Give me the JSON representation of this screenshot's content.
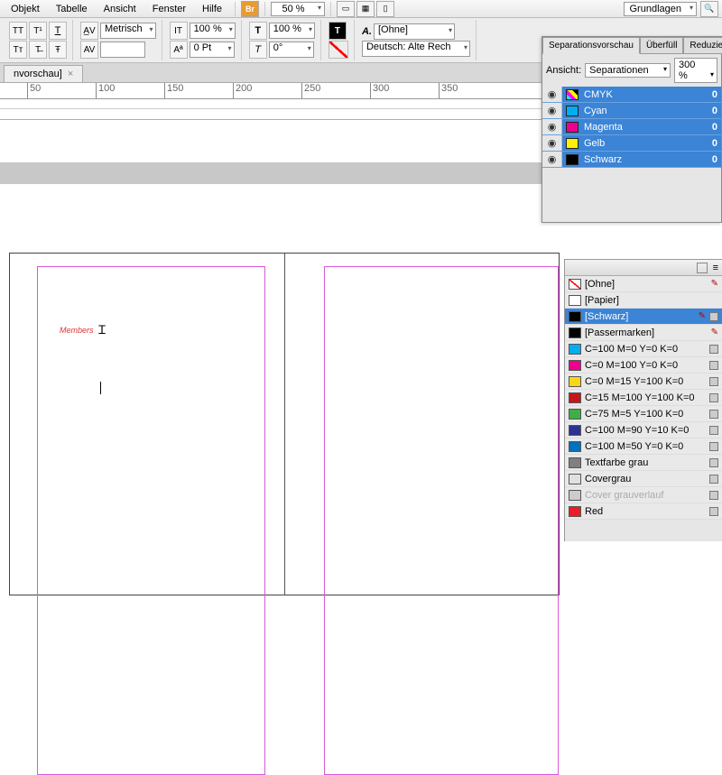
{
  "menu": {
    "items": [
      "Objekt",
      "Tabelle",
      "Ansicht",
      "Fenster",
      "Hilfe"
    ],
    "br": "Br",
    "zoom": "50 %",
    "workspace": "Grundlagen"
  },
  "toolbar": {
    "metric": "Metrisch",
    "pct1": "100 %",
    "pct2": "100 %",
    "pt": "0 Pt",
    "deg": "0°",
    "ohne": "[Ohne]",
    "lang": "Deutsch: Alte Rech"
  },
  "tab": {
    "name": "nvorschau]"
  },
  "ruler": [
    "50",
    "100",
    "150",
    "200",
    "250",
    "300",
    "350"
  ],
  "canvas": {
    "text": "Members"
  },
  "sep": {
    "tabs": [
      "Separationsvorschau",
      "Überfüll",
      "Reduzie"
    ],
    "ansicht_label": "Ansicht:",
    "ansicht_value": "Separationen",
    "zoom": "300 %",
    "rows": [
      {
        "name": "CMYK",
        "color": "linear-gradient(45deg,cyan 25%,magenta 25%,magenta 50%,yellow 50%,yellow 75%,black 75%)",
        "val": "0"
      },
      {
        "name": "Cyan",
        "color": "#00aeef",
        "val": "0"
      },
      {
        "name": "Magenta",
        "color": "#ec008c",
        "val": "0"
      },
      {
        "name": "Gelb",
        "color": "#fff200",
        "val": "0"
      },
      {
        "name": "Schwarz",
        "color": "#000000",
        "val": "0"
      }
    ]
  },
  "swatches": [
    {
      "name": "[Ohne]",
      "chip": "none",
      "end": "pencil"
    },
    {
      "name": "[Papier]",
      "chip": "#ffffff"
    },
    {
      "name": "[Schwarz]",
      "chip": "#000000",
      "selected": true,
      "end": "pencil-box"
    },
    {
      "name": "[Passermarken]",
      "chip": "#000000",
      "end": "pencil"
    },
    {
      "name": "C=100 M=0 Y=0 K=0",
      "chip": "#00aeef",
      "end": "box"
    },
    {
      "name": "C=0 M=100 Y=0 K=0",
      "chip": "#ec008c",
      "end": "box"
    },
    {
      "name": "C=0 M=15 Y=100 K=0",
      "chip": "#f9d616",
      "end": "box"
    },
    {
      "name": "C=15 M=100 Y=100 K=0",
      "chip": "#c4161c",
      "end": "box"
    },
    {
      "name": "C=75 M=5 Y=100 K=0",
      "chip": "#3fae49",
      "end": "box"
    },
    {
      "name": "C=100 M=90 Y=10 K=0",
      "chip": "#2e3192",
      "end": "box"
    },
    {
      "name": "C=100 M=50 Y=0 K=0",
      "chip": "#0071bc",
      "end": "box"
    },
    {
      "name": "Textfarbe grau",
      "chip": "#808080",
      "end": "box"
    },
    {
      "name": "Covergrau",
      "chip": "#e0e0e0",
      "end": "box"
    },
    {
      "name": "Cover grauverlauf",
      "chip": "#cccccc",
      "disabled": true,
      "end": "box"
    },
    {
      "name": "Red",
      "chip": "#ed1c24",
      "end": "box"
    }
  ]
}
